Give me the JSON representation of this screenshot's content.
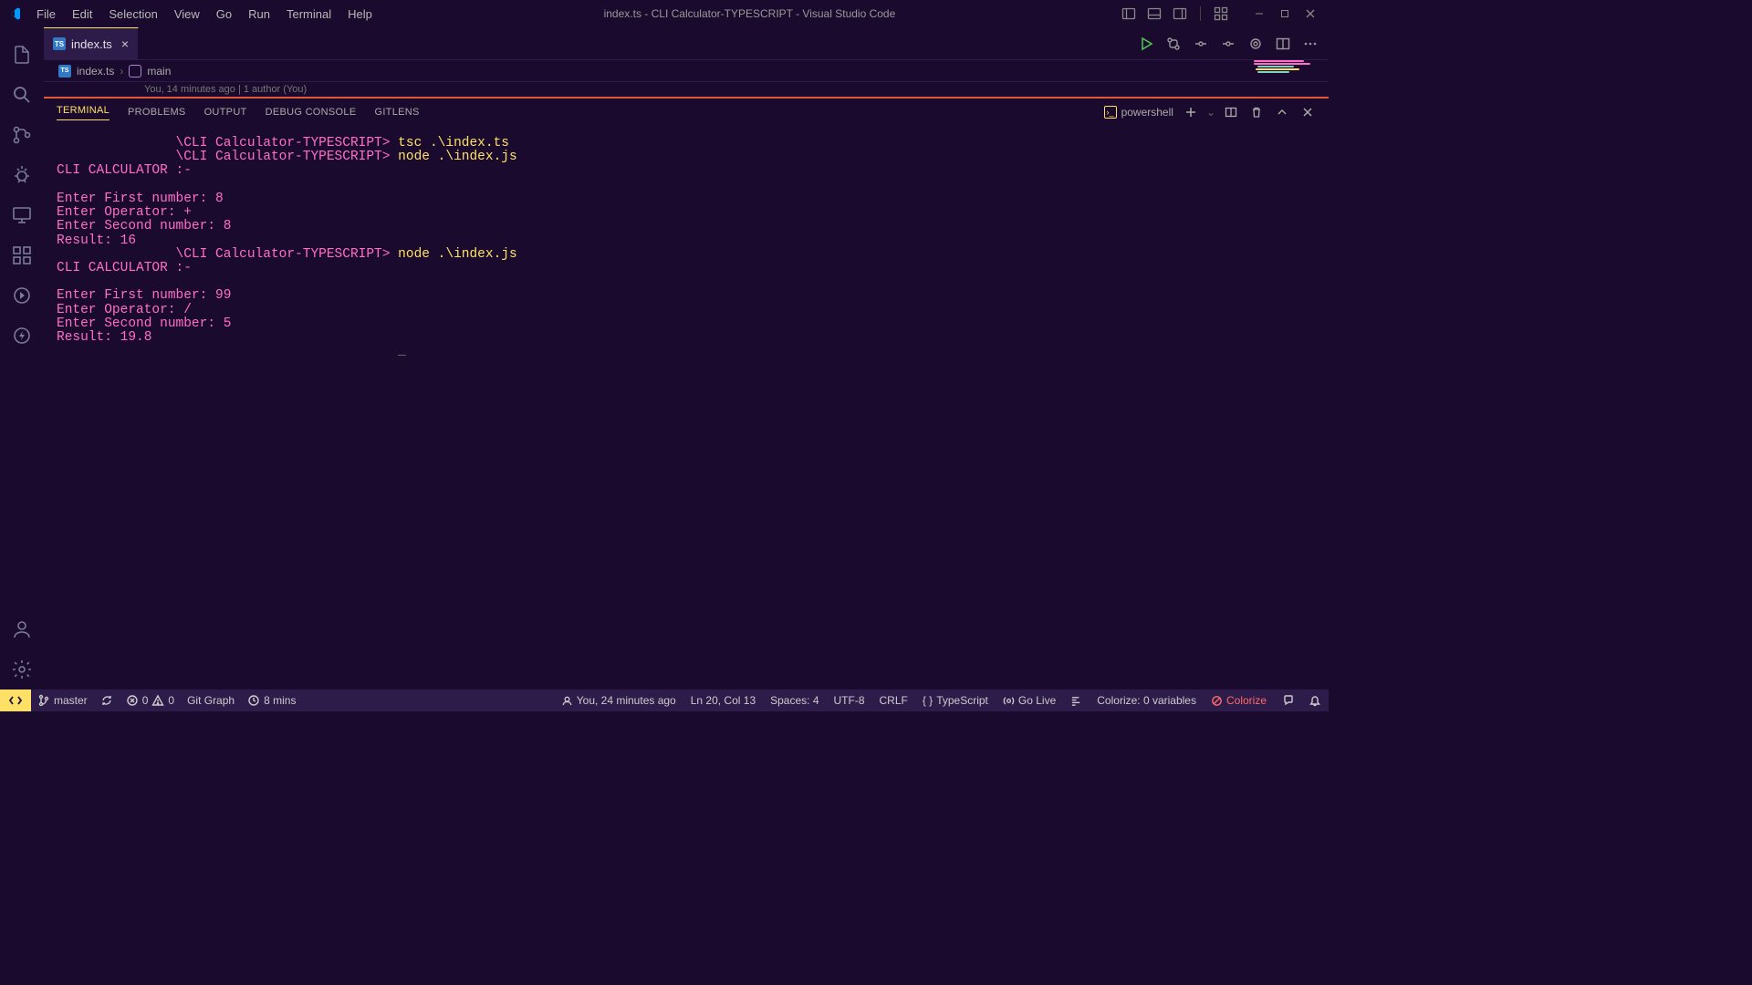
{
  "title": "index.ts - CLI Calculator-TYPESCRIPT - Visual Studio Code",
  "menu": [
    "File",
    "Edit",
    "Selection",
    "View",
    "Go",
    "Run",
    "Terminal",
    "Help"
  ],
  "tab": {
    "label": "index.ts"
  },
  "breadcrumb": {
    "file": "index.ts",
    "symbol": "main"
  },
  "blame": "You, 14 minutes ago | 1 author (You)",
  "panel": {
    "tabs": [
      "TERMINAL",
      "PROBLEMS",
      "OUTPUT",
      "DEBUG CONSOLE",
      "GITLENS"
    ],
    "shell": "powershell"
  },
  "terminal": {
    "lines": [
      {
        "prompt": "               \\CLI Calculator-TYPESCRIPT> ",
        "cmd": "tsc .\\index.ts"
      },
      {
        "prompt": "               \\CLI Calculator-TYPESCRIPT> ",
        "cmd": "node .\\index.js"
      },
      {
        "out": "CLI CALCULATOR :-"
      },
      {
        "out": ""
      },
      {
        "out": "Enter First number: 8"
      },
      {
        "out": "Enter Operator: +"
      },
      {
        "out": "Enter Second number: 8"
      },
      {
        "out": "Result: 16"
      },
      {
        "prompt": "               \\CLI Calculator-TYPESCRIPT> ",
        "cmd": "node .\\index.js"
      },
      {
        "out": "CLI CALCULATOR :-"
      },
      {
        "out": ""
      },
      {
        "out": "Enter First number: 99"
      },
      {
        "out": "Enter Operator: /"
      },
      {
        "out": "Enter Second number: 5"
      },
      {
        "out": "Result: 19.8"
      }
    ]
  },
  "status": {
    "branch": "master",
    "errors": "0",
    "warnings": "0",
    "gitgraph": "Git Graph",
    "time": "8 mins",
    "blame": "You, 24 minutes ago",
    "position": "Ln 20, Col 13",
    "spaces": "Spaces: 4",
    "encoding": "UTF-8",
    "eol": "CRLF",
    "lang": "TypeScript",
    "golive": "Go Live",
    "colorize": "Colorize: 0 variables",
    "colorize_btn": "Colorize"
  }
}
